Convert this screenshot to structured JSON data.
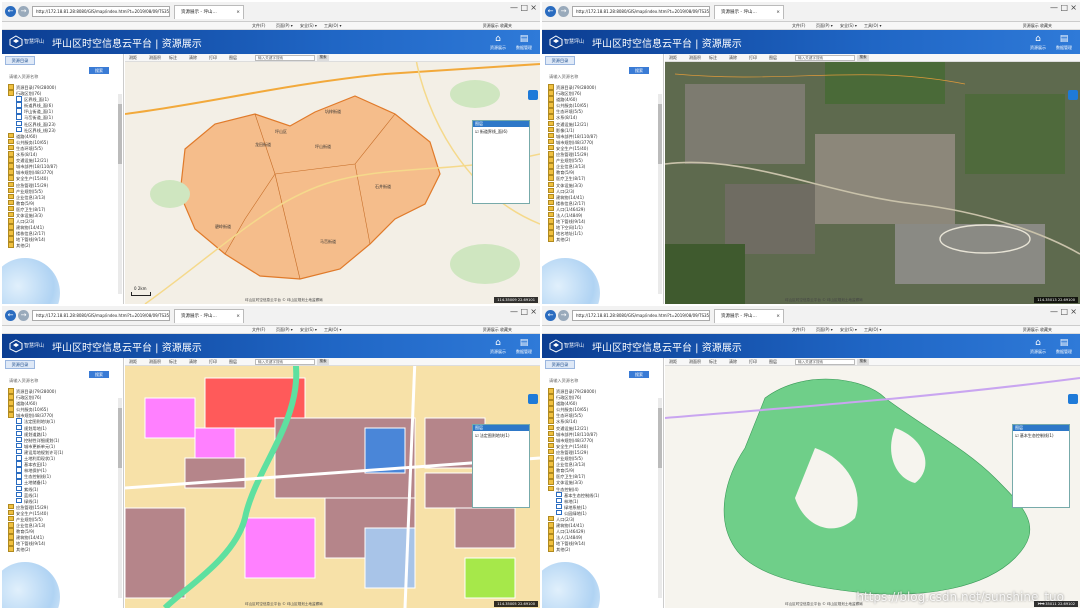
{
  "browser": {
    "url": "http://172.18.81.28:8080/GIS/map/index.html?t=2019/08/09/TS3568",
    "tab_title": "资源展示 - 坪山...",
    "nav_back": "←",
    "nav_forward": "→",
    "tab_close": "×",
    "win_min": "—",
    "win_max": "□",
    "win_close": "×",
    "tools": "★ ⚙",
    "menu": [
      "文件(F)",
      "页面(P) ▾",
      "安全(S) ▾",
      "工具(O) ▾"
    ],
    "favorites_bar": "资源展示  收藏夹"
  },
  "app": {
    "logo_text": "智慧坪山",
    "title": "坪山区时空信息云平台 | 资源展示",
    "header_buttons": [
      {
        "glyph": "⌂",
        "label": "资源展示"
      },
      {
        "glyph": "▤",
        "label": "数据管理"
      }
    ]
  },
  "sidebar": {
    "tab_label": "资源目录",
    "search_button": "搜索",
    "search_placeholder": "请输入资源名称"
  },
  "panes": [
    {
      "id": "vector-map",
      "tree": [
        {
          "label": "资源目录(79/28000)",
          "level": 0
        },
        {
          "label": "行政区划(76)",
          "level": 0
        },
        {
          "label": "区界线_面(1)",
          "level": 1
        },
        {
          "label": "街道界线_面(6)",
          "level": 1
        },
        {
          "label": "坪山街道_面(1)",
          "level": 1
        },
        {
          "label": "马峦街道_面(1)",
          "level": 1
        },
        {
          "label": "社区界线_面(23)",
          "level": 1
        },
        {
          "label": "社区界线_线(23)",
          "level": 1
        },
        {
          "label": "道路(4/60)",
          "level": 0
        },
        {
          "label": "公共服务(10/65)",
          "level": 0
        },
        {
          "label": "生态环境(5/5)",
          "level": 0
        },
        {
          "label": "水系(8/14)",
          "level": 0
        },
        {
          "label": "交通设施(12/21)",
          "level": 0
        },
        {
          "label": "城市部件(18/110/87)",
          "level": 0
        },
        {
          "label": "城市规划(48/3770)",
          "level": 0
        },
        {
          "label": "安全生产(15/40)",
          "level": 0
        },
        {
          "label": "应急管理(15/29)",
          "level": 0
        },
        {
          "label": "产业规划(5/5)",
          "level": 0
        },
        {
          "label": "企业信息(3/13)",
          "level": 0
        },
        {
          "label": "教育(5/9)",
          "level": 0
        },
        {
          "label": "医疗卫生(8/17)",
          "level": 0
        },
        {
          "label": "文体设施(3/3)",
          "level": 0
        },
        {
          "label": "人口(2/3)",
          "level": 0
        },
        {
          "label": "建筑物(14/41)",
          "level": 0
        },
        {
          "label": "楼栋信息(2/17)",
          "level": 0
        },
        {
          "label": "地下管线(9/14)",
          "level": 0
        },
        {
          "label": "其他(2)",
          "level": 0
        }
      ],
      "panel_title": "图层",
      "panel_item": "☑ 街道界线_面(6)",
      "labels": [
        "坪山街道",
        "龙田街道",
        "坑梓街道",
        "石井街道",
        "马峦街道",
        "碧岭街道",
        "坪山区"
      ],
      "coords": "114.35009 22.69101",
      "scale": "0  2km"
    },
    {
      "id": "satellite",
      "tree": [
        {
          "label": "资源目录(79/28000)",
          "level": 0
        },
        {
          "label": "行政区划(76)",
          "level": 0
        },
        {
          "label": "道路(4/60)",
          "level": 0
        },
        {
          "label": "公共服务(10/65)",
          "level": 0
        },
        {
          "label": "生态环境(5/5)",
          "level": 0
        },
        {
          "label": "水系(8/14)",
          "level": 0
        },
        {
          "label": "交通设施(12/21)",
          "level": 0
        },
        {
          "label": "影像(1/1)",
          "level": 0
        },
        {
          "label": "城市部件(18/110/87)",
          "level": 0
        },
        {
          "label": "城市规划(48/3770)",
          "level": 0
        },
        {
          "label": "安全生产(15/40)",
          "level": 0
        },
        {
          "label": "应急管理(15/29)",
          "level": 0
        },
        {
          "label": "产业规划(5/5)",
          "level": 0
        },
        {
          "label": "企业信息(3/13)",
          "level": 0
        },
        {
          "label": "教育(5/9)",
          "level": 0
        },
        {
          "label": "医疗卫生(8/17)",
          "level": 0
        },
        {
          "label": "文体设施(3/3)",
          "level": 0
        },
        {
          "label": "人口(2/3)",
          "level": 0
        },
        {
          "label": "建筑物(14/41)",
          "level": 0
        },
        {
          "label": "楼栋信息(2/17)",
          "level": 0
        },
        {
          "label": "人口(1/46429)",
          "level": 0
        },
        {
          "label": "法人(1/4849)",
          "level": 0
        },
        {
          "label": "地下管线(9/14)",
          "level": 0
        },
        {
          "label": "地下空间(1/1)",
          "level": 0
        },
        {
          "label": "地名地址(1/1)",
          "level": 0
        },
        {
          "label": "其他(2)",
          "level": 0
        }
      ],
      "coords": "114.35013 22.69100",
      "scale": ""
    },
    {
      "id": "landuse",
      "tree": [
        {
          "label": "资源目录(79/28000)",
          "level": 0
        },
        {
          "label": "行政区划(76)",
          "level": 0
        },
        {
          "label": "道路(4/60)",
          "level": 0
        },
        {
          "label": "公共服务(10/65)",
          "level": 0
        },
        {
          "label": "城市规划(48/3770)",
          "level": 0
        },
        {
          "label": "法定图则地块(1)",
          "level": 1
        },
        {
          "label": "规划用地(1)",
          "level": 1
        },
        {
          "label": "规划道路(1)",
          "level": 1
        },
        {
          "label": "控制性详细规划(1)",
          "level": 1
        },
        {
          "label": "城市更新单元(1)",
          "level": 1
        },
        {
          "label": "建设用地规划许可(1)",
          "level": 1
        },
        {
          "label": "土地利用现状(1)",
          "level": 1
        },
        {
          "label": "基本农田(1)",
          "level": 1
        },
        {
          "label": "林地保护(1)",
          "level": 1
        },
        {
          "label": "生态控制线(1)",
          "level": 1
        },
        {
          "label": "土地储备(1)",
          "level": 1
        },
        {
          "label": "紫线(1)",
          "level": 1
        },
        {
          "label": "蓝线(1)",
          "level": 1
        },
        {
          "label": "绿线(1)",
          "level": 1
        },
        {
          "label": "应急管理(15/29)",
          "level": 0
        },
        {
          "label": "安全生产(15/40)",
          "level": 0
        },
        {
          "label": "产业规划(5/5)",
          "level": 0
        },
        {
          "label": "企业信息(3/13)",
          "level": 0
        },
        {
          "label": "教育(5/9)",
          "level": 0
        },
        {
          "label": "建筑物(14/41)",
          "level": 0
        },
        {
          "label": "地下管线(9/14)",
          "level": 0
        },
        {
          "label": "其他(2)",
          "level": 0
        }
      ],
      "panel_title": "图层",
      "panel_item": "☑ 法定图则地块(1)",
      "coords": "114.35005 22.69100",
      "scale": ""
    },
    {
      "id": "ecology",
      "tree": [
        {
          "label": "资源目录(79/28000)",
          "level": 0
        },
        {
          "label": "行政区划(76)",
          "level": 0
        },
        {
          "label": "道路(4/60)",
          "level": 0
        },
        {
          "label": "公共服务(10/65)",
          "level": 0
        },
        {
          "label": "生态环境(5/5)",
          "level": 0
        },
        {
          "label": "水系(8/14)",
          "level": 0
        },
        {
          "label": "交通设施(12/21)",
          "level": 0
        },
        {
          "label": "城市部件(18/110/87)",
          "level": 0
        },
        {
          "label": "城市规划(48/3770)",
          "level": 0
        },
        {
          "label": "安全生产(15/40)",
          "level": 0
        },
        {
          "label": "应急管理(15/29)",
          "level": 0
        },
        {
          "label": "产业规划(5/5)",
          "level": 0
        },
        {
          "label": "企业信息(3/13)",
          "level": 0
        },
        {
          "label": "教育(5/9)",
          "level": 0
        },
        {
          "label": "医疗卫生(8/17)",
          "level": 0
        },
        {
          "label": "文体设施(3/3)",
          "level": 0
        },
        {
          "label": "生态控制(4)",
          "level": 0
        },
        {
          "label": "基本生态控制线(1)",
          "level": 1
        },
        {
          "label": "林地(1)",
          "level": 1
        },
        {
          "label": "绿地系统(1)",
          "level": 1
        },
        {
          "label": "公园绿地(1)",
          "level": 1
        },
        {
          "label": "人口(2/3)",
          "level": 0
        },
        {
          "label": "建筑物(14/41)",
          "level": 0
        },
        {
          "label": "人口(1/46429)",
          "level": 0
        },
        {
          "label": "法人(1/4849)",
          "level": 0
        },
        {
          "label": "地下管线(9/14)",
          "level": 0
        },
        {
          "label": "其他(2)",
          "level": 0
        }
      ],
      "panel_title": "图层",
      "panel_item": "☑ 基本生态控制线(1)",
      "coords": "114.35011 22.69102",
      "scale": ""
    }
  ],
  "map_toolbar": [
    "测距",
    "测面积",
    "标注",
    "清除",
    "打印",
    "图层"
  ],
  "map_search_placeholder": "输入关键字搜索",
  "map_search_button": "搜索",
  "copyright": "坪山区时空信息云平台 © 坪山区规划土地监察局",
  "watermark": "https://blog.csdn.net/sunshine_tuo"
}
